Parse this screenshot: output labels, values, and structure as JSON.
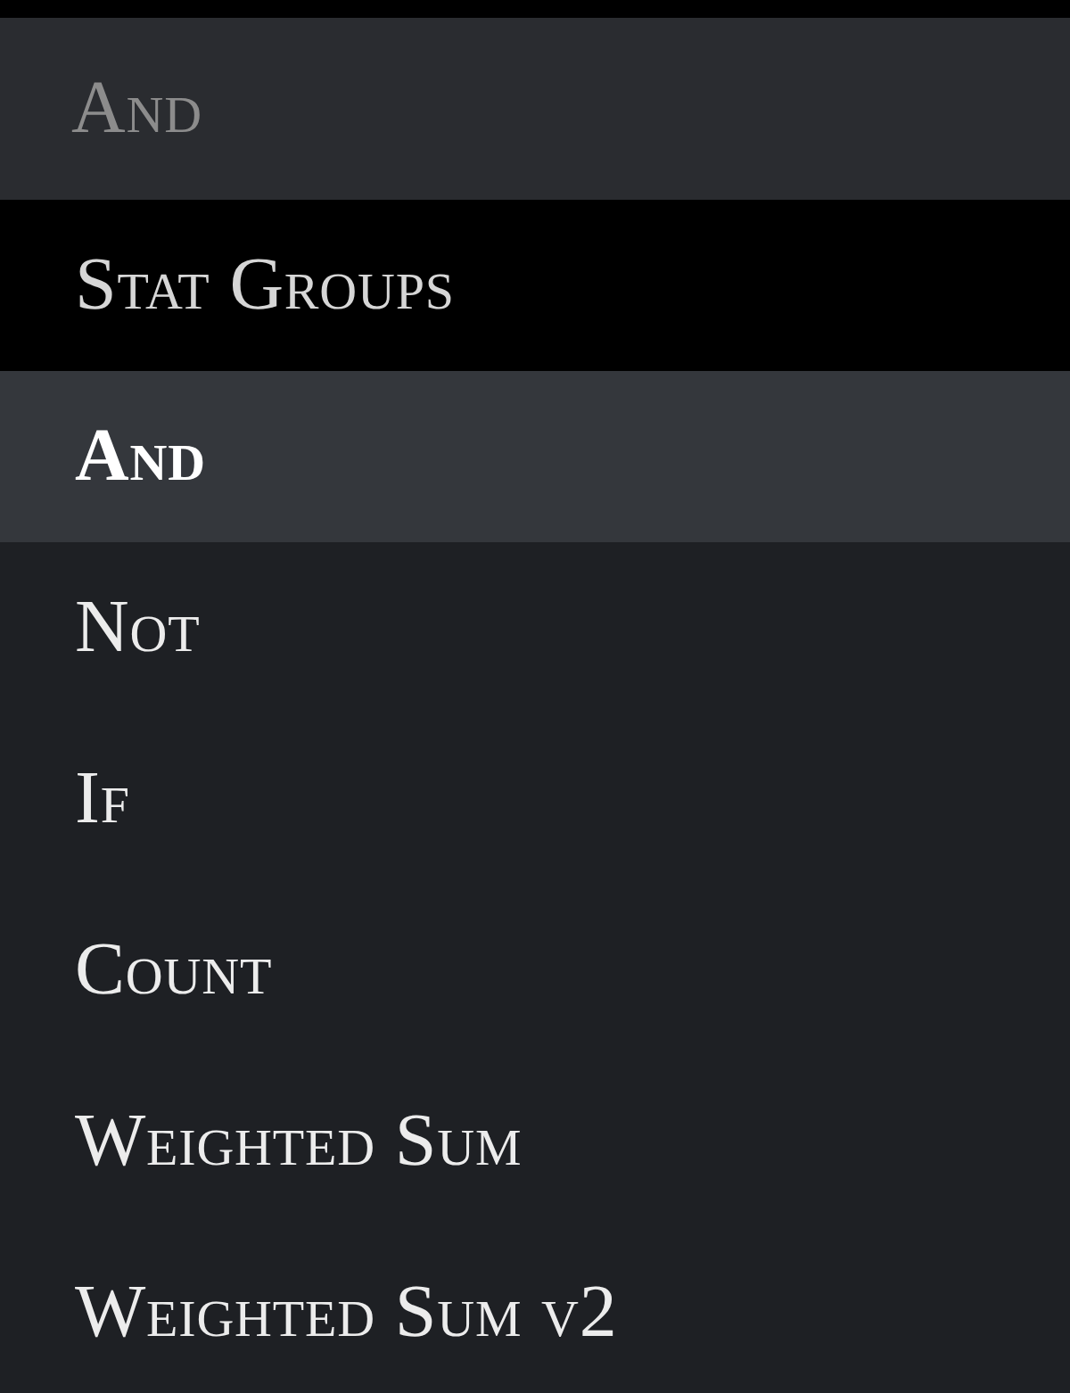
{
  "dropdown": {
    "value": "And",
    "group": {
      "label": "Stat Groups",
      "options": [
        {
          "label": "And",
          "selected": true
        },
        {
          "label": "Not",
          "selected": false
        },
        {
          "label": "If",
          "selected": false
        },
        {
          "label": "Count",
          "selected": false
        },
        {
          "label": "Weighted Sum",
          "selected": false
        },
        {
          "label": "Weighted Sum v2",
          "selected": false
        }
      ]
    }
  }
}
